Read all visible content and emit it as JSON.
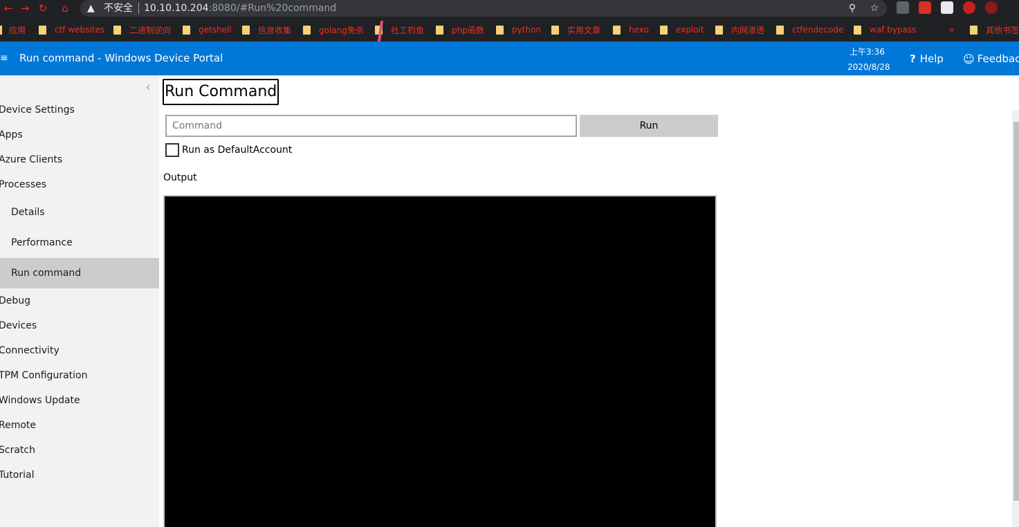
{
  "browser": {
    "security_label": "不安全",
    "url_host": "10.10.10.204",
    "url_rest": ":8080/#Run%20command",
    "icons": {
      "back": "arrow-left-icon",
      "forward": "arrow-right-icon",
      "reload": "reload-icon",
      "home": "home-icon",
      "warning": "warning-icon",
      "key": "key-icon",
      "star": "star-icon"
    },
    "bookmarks": [
      {
        "label": "应用"
      },
      {
        "label": "ctf websites"
      },
      {
        "label": "二进制逆向"
      },
      {
        "label": "getshell"
      },
      {
        "label": "信息收集"
      },
      {
        "label": "golang免杀"
      },
      {
        "label": "社工钓鱼"
      },
      {
        "label": "php函数"
      },
      {
        "label": "python"
      },
      {
        "label": "实用文章"
      },
      {
        "label": "hexo"
      },
      {
        "label": "exploit"
      },
      {
        "label": "内网渗透"
      },
      {
        "label": "ctfendecode"
      },
      {
        "label": "waf bypass"
      },
      {
        "label": "其他书签"
      }
    ]
  },
  "header": {
    "title": "Run command - Windows Device Portal",
    "time": "上午3:36",
    "date": "2020/8/28",
    "help": "Help",
    "feedback": "Feedback",
    "accent_color": "#0078d7"
  },
  "sidebar": {
    "items": [
      {
        "label": "Device Settings"
      },
      {
        "label": "Apps"
      },
      {
        "label": "Azure Clients"
      },
      {
        "label": "Processes"
      }
    ],
    "sub_items": [
      {
        "label": "Details"
      },
      {
        "label": "Performance"
      },
      {
        "label": "Run command",
        "selected": true
      }
    ],
    "items_after": [
      {
        "label": "Debug"
      },
      {
        "label": "Devices"
      },
      {
        "label": "Connectivity"
      },
      {
        "label": "TPM Configuration"
      },
      {
        "label": "Windows Update"
      },
      {
        "label": "Remote"
      },
      {
        "label": "Scratch"
      },
      {
        "label": "Tutorial"
      }
    ]
  },
  "main": {
    "title": "Run Command",
    "command_placeholder": "Command",
    "command_value": "",
    "run_label": "Run",
    "checkbox_label": "Run as DefaultAccount",
    "checkbox_checked": false,
    "output_label": "Output"
  }
}
